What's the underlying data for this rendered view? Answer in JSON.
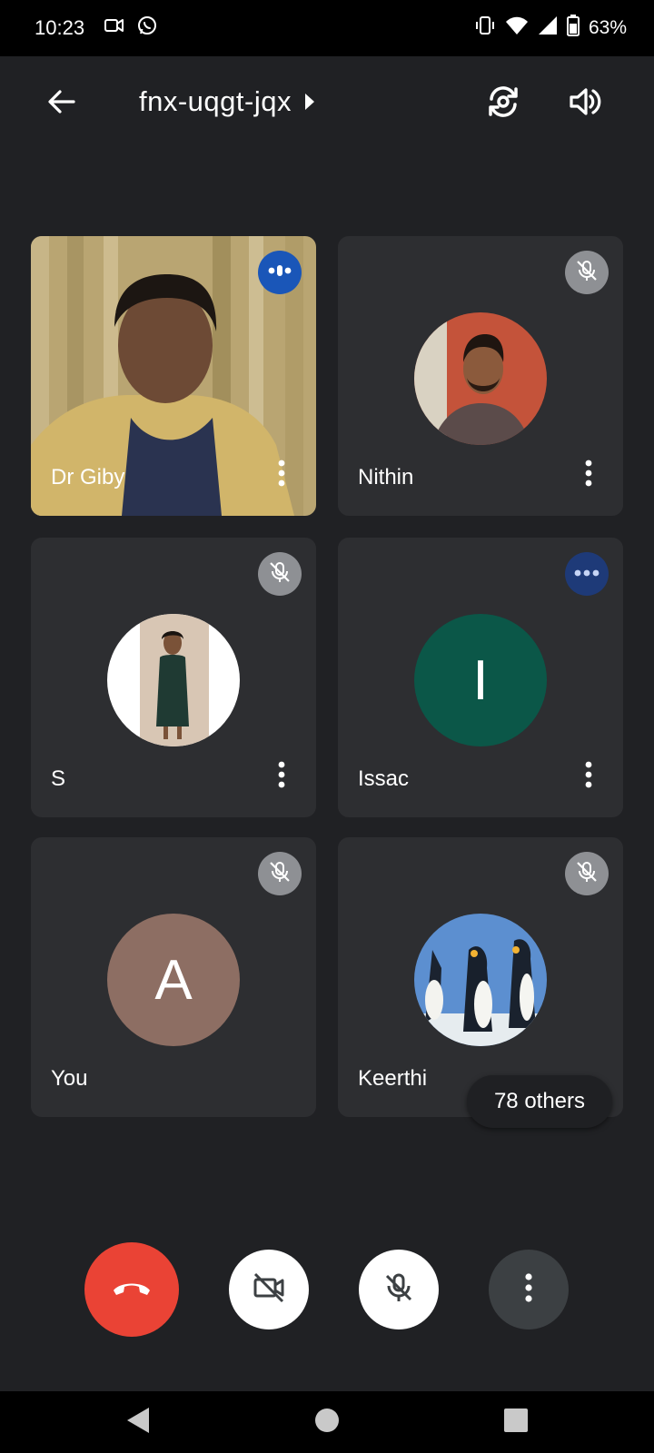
{
  "status_bar": {
    "time": "10:23",
    "battery": "63%",
    "icons": [
      "video-camera-icon",
      "whatsapp-icon",
      "vibrate-icon",
      "wifi-icon",
      "cell-signal-icon",
      "battery-icon"
    ]
  },
  "header": {
    "meeting_code": "fnx-uqgt-jqx",
    "back_icon": "arrow-left-icon",
    "switch_camera_icon": "switch-camera-icon",
    "speaker_icon": "speaker-icon"
  },
  "participants": [
    {
      "name": "Dr Giby",
      "state": "speaking",
      "media": "video"
    },
    {
      "name": "Nithin",
      "state": "muted",
      "media": "photo-avatar"
    },
    {
      "name": "S",
      "state": "muted",
      "media": "photo-avatar"
    },
    {
      "name": "Issac",
      "state": "speaking",
      "media": "letter-avatar",
      "letter": "I",
      "color": "#0b5748"
    },
    {
      "name": "You",
      "state": "muted",
      "media": "letter-avatar",
      "letter": "A",
      "color": "#8d6e63"
    },
    {
      "name": "Keerthi",
      "state": "muted",
      "media": "photo-avatar"
    }
  ],
  "others_chip": "78 others",
  "controls": {
    "end_call_icon": "end-call-icon",
    "camera_icon": "camera-off-icon",
    "mic_icon": "mic-off-icon",
    "more_icon": "more-vert-icon",
    "end_call_color": "#ea4335"
  },
  "navigation": {
    "back": "nav-back-icon",
    "home": "nav-home-icon",
    "recents": "nav-recents-icon"
  }
}
